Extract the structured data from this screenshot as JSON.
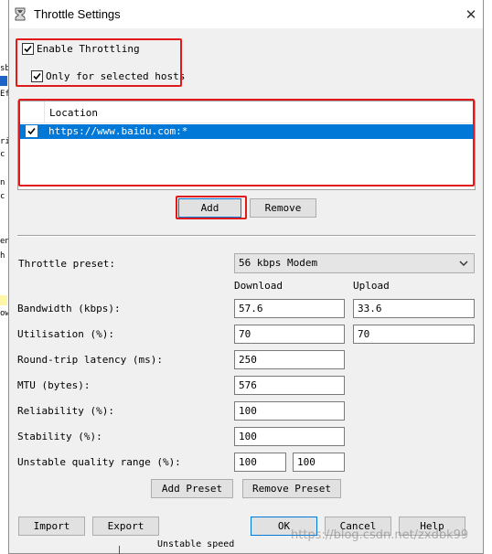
{
  "window": {
    "title": "Throttle Settings",
    "close_glyph": "✕"
  },
  "throttling": {
    "enable_label": "Enable Throttling",
    "enable_checked": true,
    "selected_hosts_label": "Only for selected hosts",
    "selected_hosts_checked": true
  },
  "hosts_list": {
    "column_header": "Location",
    "rows": [
      {
        "checked": true,
        "location": "https://www.baidu.com:*"
      }
    ]
  },
  "list_buttons": {
    "add": "Add",
    "remove": "Remove"
  },
  "preset": {
    "label": "Throttle preset:",
    "selected": "56 kbps Modem"
  },
  "columns": {
    "download": "Download",
    "upload": "Upload"
  },
  "fields": {
    "bandwidth": {
      "label": "Bandwidth (kbps):",
      "download": "57.6",
      "upload": "33.6"
    },
    "utilisation": {
      "label": "Utilisation (%):",
      "download": "70",
      "upload": "70"
    },
    "latency": {
      "label": "Round-trip latency (ms):",
      "value": "250"
    },
    "mtu": {
      "label": "MTU (bytes):",
      "value": "576"
    },
    "reliability": {
      "label": "Reliability (%):",
      "value": "100"
    },
    "stability": {
      "label": "Stability (%):",
      "value": "100"
    },
    "unstable_range": {
      "label": "Unstable quality range (%):",
      "min": "100",
      "max": "100"
    }
  },
  "preset_buttons": {
    "add": "Add Preset",
    "remove": "Remove Preset"
  },
  "footer": {
    "import": "Import",
    "export": "Export",
    "ok": "OK",
    "cancel": "Cancel",
    "help": "Help"
  },
  "watermark": "https://blog.csdn.net/zxdbk99",
  "background_fragments": [
    "sb",
    "Ef",
    "ri",
    "c",
    "n",
    "c",
    "en",
    "h",
    "ow"
  ],
  "bottom_fragment": "Unstable speed",
  "colors": {
    "accent": "#0078d7",
    "highlight_box": "#e0191b",
    "dialog_bg": "#f0f0f0"
  }
}
